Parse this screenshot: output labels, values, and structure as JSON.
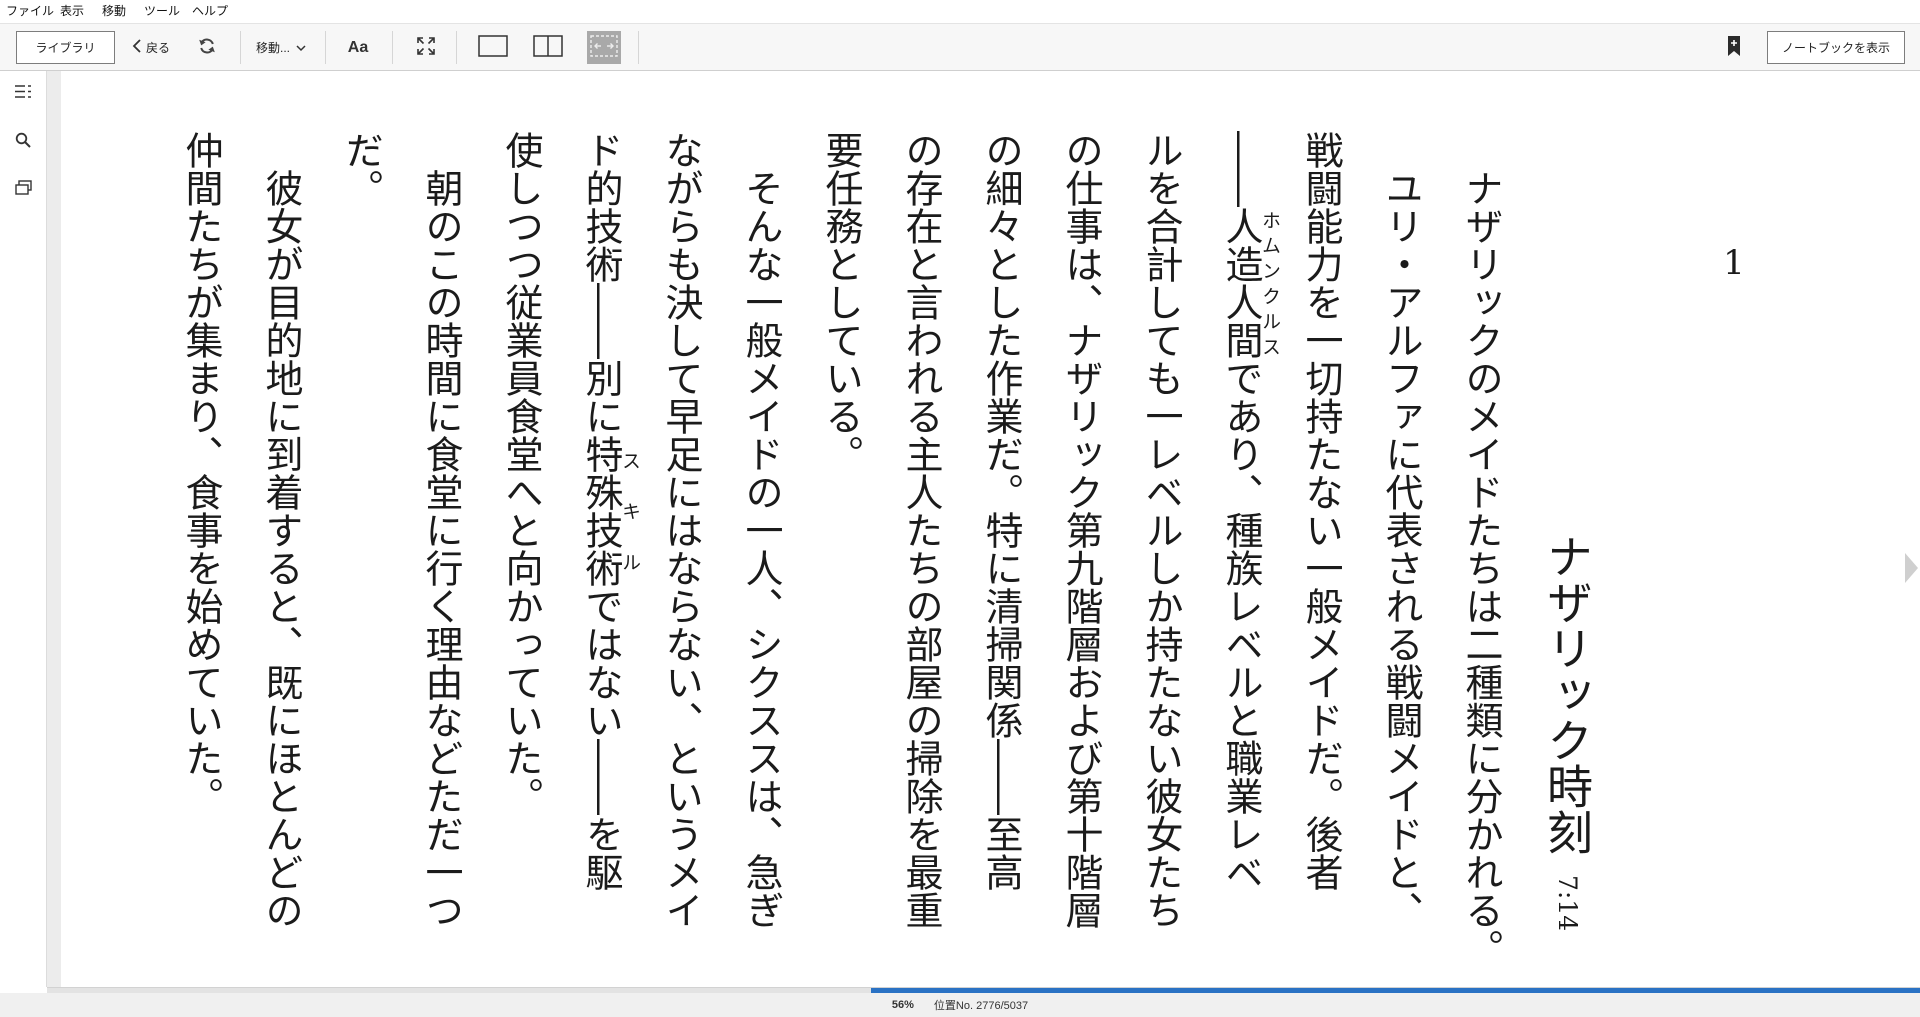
{
  "theme": {
    "accent": "#2a72c4",
    "selected_tool": "#a9a9a9",
    "next_arrow": "#cfcfcf"
  },
  "menu": {
    "items": [
      "ファイル",
      "表示",
      "移動",
      "ツール",
      "ヘルプ"
    ]
  },
  "toolbar": {
    "library_label": "ライブラリ",
    "back_label": "戻る",
    "goto_label": "移動...",
    "font_label": "Aa",
    "notebook_label": "ノートブックを表示",
    "icons": [
      "chevron-left-icon",
      "refresh-icon",
      "chevron-down-icon",
      "fullscreen-icon",
      "single-page-icon",
      "two-page-icon",
      "fit-page-icon",
      "add-bookmark-icon"
    ]
  },
  "sidebar": {
    "icons": [
      "table-of-contents-icon",
      "search-icon",
      "flashcards-icon"
    ]
  },
  "book": {
    "chapter_number": "1",
    "chapter_title": "ナザリック時刻",
    "chapter_time": "7:14",
    "columns": [
      {
        "text": "　ナザリックのメイドたちは二種類に分かれる。"
      },
      {
        "text": "　ユリ・アルファに代表される戦闘メイドと、"
      },
      {
        "text": "戦闘能力を一切持たない一般メイドだ。後者"
      },
      {
        "before": "――",
        "base": "人造人間",
        "ruby": "ホムンクルス",
        "after": "であり、種族レベルと職業レベ"
      },
      {
        "text": "ルを合計しても一レベルしか持たない彼女たち"
      },
      {
        "text": "の仕事は、ナザリック第九階層および第十階層"
      },
      {
        "text": "の細々とした作業だ。特に清掃関係――至高"
      },
      {
        "text": "の存在と言われる主人たちの部屋の掃除を最重"
      },
      {
        "text": "要任務としている。"
      },
      {
        "text": "　そんな一般メイドの一人、シクススは、急ぎ"
      },
      {
        "text": "ながらも決して早足にはならない、というメイ"
      },
      {
        "before": "ド的技術――別に",
        "base": "特殊技術",
        "ruby": "スキル",
        "after": "ではない――を駆"
      },
      {
        "text": "使しつつ従業員食堂へと向かっていた。"
      },
      {
        "text": "　朝のこの時間に食堂に行く理由などただ一つ"
      },
      {
        "text": "だ。"
      },
      {
        "text": "　彼女が目的地に到着すると、既にほとんどの"
      },
      {
        "text": "仲間たちが集まり、食事を始めていた。"
      }
    ]
  },
  "status": {
    "percent_label": "56%",
    "location_label": "位置No. 2776/5037",
    "progress": 0.56
  }
}
